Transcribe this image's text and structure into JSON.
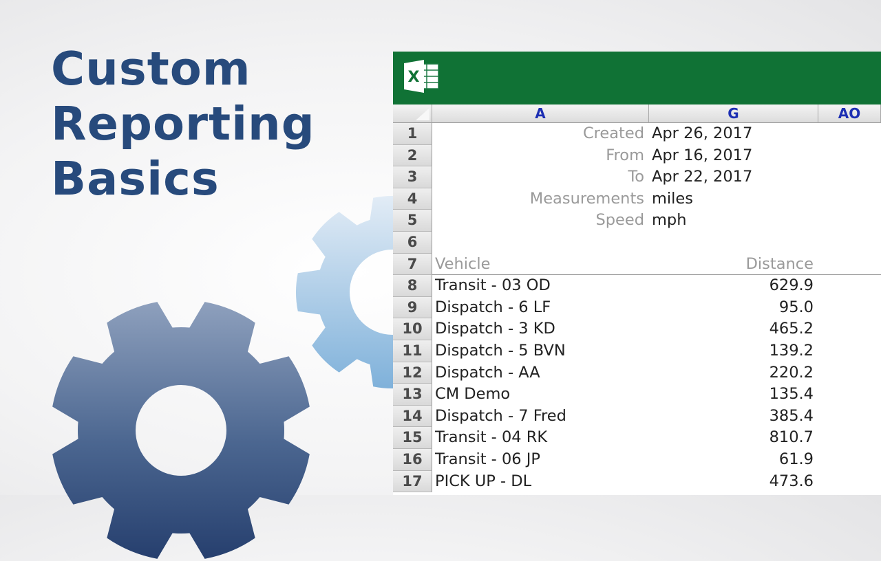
{
  "title": {
    "line1": "Custom",
    "line2": "Reporting",
    "line3": "Basics"
  },
  "colors": {
    "title": "#274a7c",
    "banner": "#107235",
    "column_header_text": "#1d2fb3"
  },
  "spreadsheet": {
    "app_icon": "excel-icon",
    "app_icon_letter": "X",
    "columns": [
      "A",
      "G",
      "AO"
    ],
    "meta": [
      {
        "row": "1",
        "label": "Created",
        "value": "Apr 26, 2017"
      },
      {
        "row": "2",
        "label": "From",
        "value": "Apr 16, 2017"
      },
      {
        "row": "3",
        "label": "To",
        "value": "Apr 22, 2017"
      },
      {
        "row": "4",
        "label": "Measurements",
        "value": "miles"
      },
      {
        "row": "5",
        "label": "Speed",
        "value": "mph"
      }
    ],
    "empty_row": "6",
    "header_row": {
      "row": "7",
      "vehicle": "Vehicle",
      "distance": "Distance"
    },
    "rows": [
      {
        "row": "8",
        "vehicle": "Transit - 03 OD",
        "distance": "629.9"
      },
      {
        "row": "9",
        "vehicle": "Dispatch - 6 LF",
        "distance": "95.0"
      },
      {
        "row": "10",
        "vehicle": "Dispatch - 3 KD",
        "distance": "465.2"
      },
      {
        "row": "11",
        "vehicle": "Dispatch - 5 BVN",
        "distance": "139.2"
      },
      {
        "row": "12",
        "vehicle": "Dispatch - AA",
        "distance": "220.2"
      },
      {
        "row": "13",
        "vehicle": "CM Demo",
        "distance": "135.4"
      },
      {
        "row": "14",
        "vehicle": "Dispatch - 7 Fred",
        "distance": "385.4"
      },
      {
        "row": "15",
        "vehicle": "Transit - 04 RK",
        "distance": "810.7"
      },
      {
        "row": "16",
        "vehicle": "Transit - 06 JP",
        "distance": "61.9"
      },
      {
        "row": "17",
        "vehicle": "PICK UP - DL",
        "distance": "473.6"
      }
    ]
  }
}
